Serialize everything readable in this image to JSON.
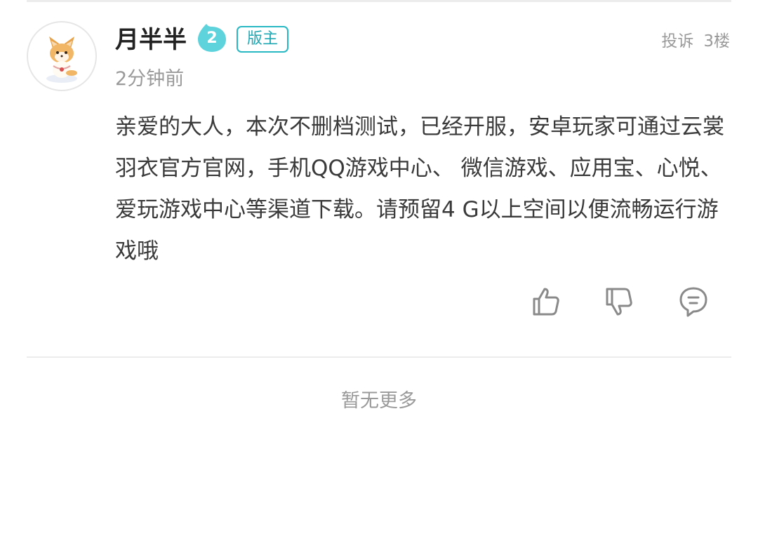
{
  "comment": {
    "username": "月半半",
    "level": "2",
    "role_badge": "版主",
    "timestamp": "2分钟前",
    "report_label": "投诉",
    "floor_label": "3楼",
    "body": "亲爱的大人，本次不删档测试，已经开服，安卓玩家可通过云裳羽衣官方官网，手机QQ游戏中心、 微信游戏、应用宝、心悦、爱玩游戏中心等渠道下载。请预留4 G以上空间以便流畅运行游戏哦",
    "actions": {
      "like_icon": "thumbs-up-icon",
      "dislike_icon": "thumbs-down-icon",
      "reply_icon": "comment-bubble-icon"
    }
  },
  "footer": {
    "no_more_text": "暂无更多"
  },
  "colors": {
    "accent": "#27b8c4",
    "level_badge": "#5fd3dc",
    "muted_text": "#9a9a9a",
    "body_text": "#3a3a3a",
    "divider": "#ececec"
  }
}
